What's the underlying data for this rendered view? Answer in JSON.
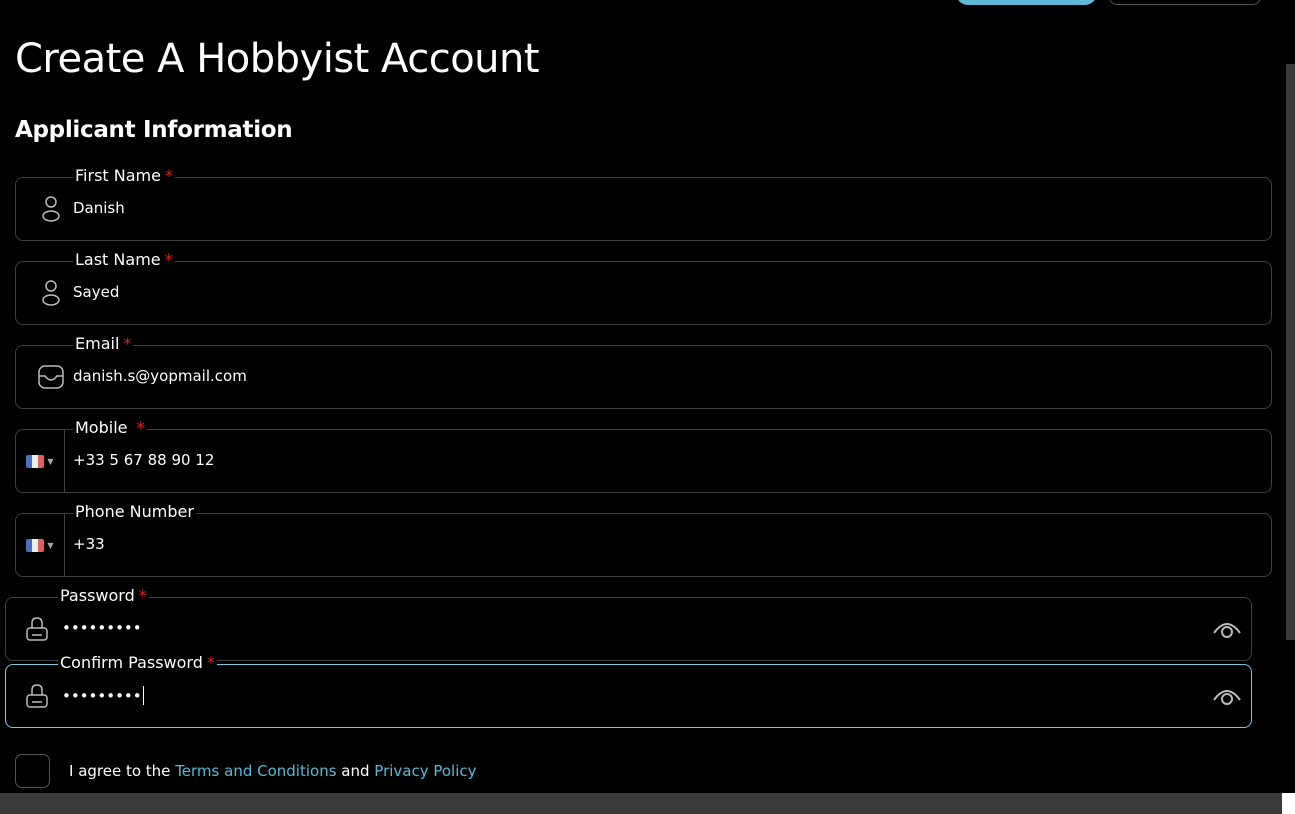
{
  "page": {
    "title": "Create A Hobbyist Account",
    "section_title": "Applicant Information"
  },
  "fields": {
    "first_name": {
      "label": "First Name",
      "required": "*",
      "value": "Danish",
      "icon": "user-icon"
    },
    "last_name": {
      "label": "Last Name",
      "required": "*",
      "value": "Sayed",
      "icon": "user-icon"
    },
    "email": {
      "label": "Email",
      "required": "*",
      "value": "danish.s@yopmail.com",
      "icon": "inbox-icon"
    },
    "mobile": {
      "label": "Mobile ",
      "required": "*",
      "value": "+33 5 67 88 90 12",
      "icon": "france-flag-icon"
    },
    "phone": {
      "label": "Phone Number",
      "value": "+33",
      "icon": "france-flag-icon"
    },
    "password": {
      "label": "Password",
      "required": "*",
      "value": "•••••••••",
      "icon": "lock-icon"
    },
    "confirm_password": {
      "label": "Confirm Password",
      "required": "*",
      "value": "•••••••••",
      "icon": "lock-icon"
    }
  },
  "agreement": {
    "prefix": "I agree to the ",
    "terms_link": "Terms and Conditions",
    "middle": " and ",
    "privacy_link": "Privacy Policy"
  },
  "colors": {
    "background": "#000000",
    "accent": "#5bb8d6",
    "required": "#e02020",
    "field_border": "#3f3f3f",
    "focus_border": "#7fc6df"
  }
}
